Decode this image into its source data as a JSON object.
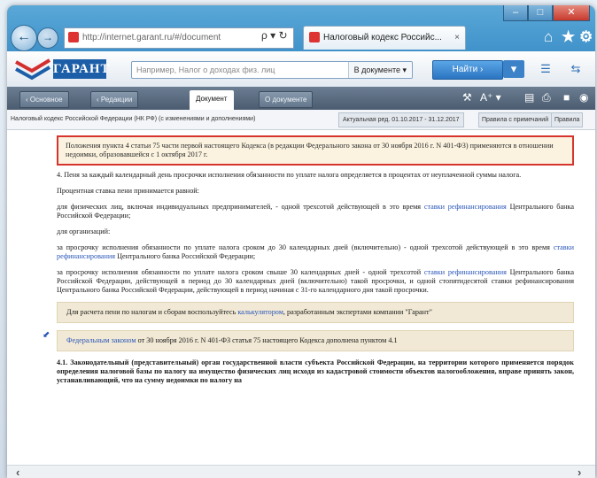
{
  "browser": {
    "address": "http://internet.garant.ru/#/document",
    "address_host": "garant.ru",
    "tab_title": "Налоговый кодекс Российс...",
    "tab_close": "×",
    "addr_controls": "ρ ▾ ↻"
  },
  "toolbar": {
    "logo_text": "ГАРАНТ",
    "search_placeholder": "Например, Налог о доходах физ. лиц",
    "search_scope": "В документе ▾",
    "find_label": "Найти ›"
  },
  "modes": {
    "tabs": [
      "‹ Основное",
      "‹ Редакции",
      "Документ",
      "О документе"
    ],
    "text_size": "A⁺ ▾"
  },
  "docrow": {
    "title": "Налоговый кодекс Российской Федерации (НК РФ) (с изменениями и дополнениями)",
    "version": "Актуальная ред. 01.10.2017 - 31.12.2017",
    "show1": "Правила с примечаний",
    "show2": "Правила"
  },
  "document": {
    "note": "Положения пункта 4 статьи 75 части первой настоящего Кодекса (в редакции Федерального закона от 30 ноября 2016 г. N 401-ФЗ) применяются в отношении недоимки, образовавшейся с 1 октября 2017 г.",
    "p1": "4. Пеня за каждый календарный день просрочки исполнения обязанности по уплате налога определяется в процентах от неуплаченной суммы налога.",
    "p2": "Процентная ставка пени принимается равной:",
    "p3a": "для физических лиц, включая индивидуальных предпринимателей, - одной трехсотой действующей в это время ",
    "p3link": "ставки рефинансирования",
    "p3b": " Центрального банка Российской Федерации;",
    "p4": "для организаций:",
    "p5a": "за просрочку исполнения обязанности по уплате налога сроком до 30 календарных дней (включительно) - одной трехсотой действующей в это время ",
    "p5link": "ставки рефинансирования",
    "p5b": " Центрального банка Российской Федерации;",
    "p6a": "за просрочку исполнения обязанности по уплате налога сроком свыше 30 календарных дней - одной трехсотой ",
    "p6link": "ставки рефинансирования",
    "p6b": " Центрального банка Российской Федерации, действующей в период до 30 календарных дней (включительно) такой просрочки, и одной стопятидесятой ставки рефинансирования Центрального банка Российской Федерации, действующей в период начиная с 31-го календарного дня такой просрочки.",
    "tan1a": "Для расчета пени по налогам и сборам воспользуйтесь ",
    "tan1link": "калькулятором",
    "tan1b": ", разработанным экспертами компании \"Гарант\"",
    "tan2link": "Федеральным законом",
    "tan2b": " от 30 ноября 2016 г. N 401-ФЗ статья 75 настоящего Кодекса дополнена пунктом 4.1",
    "p7": "4.1. Законодательный (представительный) орган государственной власти субъекта Российской Федерации, на территории которого применяется порядок определения налоговой базы по налогу на имущество физических лиц исходя из кадастровой стоимости объектов налогообложения, вправе принять закон, устанавливающий, что на сумму недоимки по налогу на"
  }
}
